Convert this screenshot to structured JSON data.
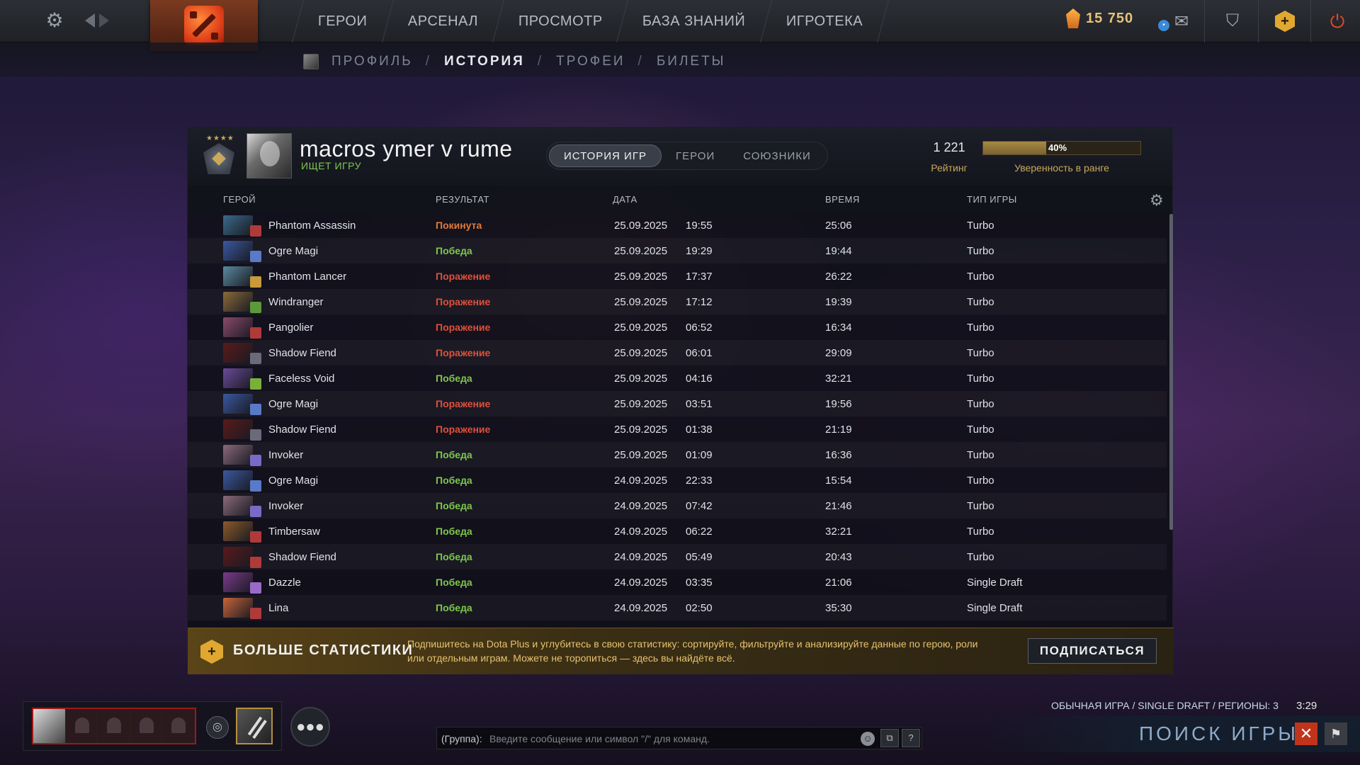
{
  "topbar": {
    "nav": [
      "ГЕРОИ",
      "АРСЕНАЛ",
      "ПРОСМОТР",
      "БАЗА ЗНАНИЙ",
      "ИГРОТЕКА"
    ],
    "currency": "15 750",
    "icons": [
      "settings-icon",
      "back-arrow-icon",
      "forward-arrow-icon",
      "dota-logo",
      "shards-icon",
      "chat-icon",
      "armory-icon",
      "dota-plus-icon",
      "power-icon"
    ]
  },
  "breadcrumb": {
    "items": [
      "ПРОФИЛЬ",
      "ИСТОРИЯ",
      "ТРОФЕИ",
      "БИЛЕТЫ"
    ],
    "active": "ИСТОРИЯ",
    "sep": "/"
  },
  "profile": {
    "name": "macros ymer v rume",
    "status": "ИЩЕТ ИГРУ",
    "tabs": [
      "ИСТОРИЯ ИГР",
      "ГЕРОИ",
      "СОЮЗНИКИ"
    ],
    "active_tab": "ИСТОРИЯ ИГР",
    "rating": "1 221",
    "rating_label": "Рейтинг",
    "confidence": "40%",
    "confidence_fraction": 0.4,
    "confidence_label": "Уверенность в ранге"
  },
  "table": {
    "headers": [
      "ГЕРОЙ",
      "РЕЗУЛЬТАТ",
      "ДАТА",
      "ВРЕМЯ",
      "ТИП ИГРЫ"
    ],
    "rows": [
      {
        "hero": "Phantom Assassin",
        "result": "Покинута",
        "kind": "aband",
        "date": "25.09.2025",
        "time": "19:55",
        "duration": "25:06",
        "type": "Turbo",
        "color": "#3a6a8a",
        "badge": "#b03a3a"
      },
      {
        "hero": "Ogre Magi",
        "result": "Победа",
        "kind": "win",
        "date": "25.09.2025",
        "time": "19:29",
        "duration": "19:44",
        "type": "Turbo",
        "color": "#3a58a0",
        "badge": "#5a7ac8"
      },
      {
        "hero": "Phantom Lancer",
        "result": "Поражение",
        "kind": "loss",
        "date": "25.09.2025",
        "time": "17:37",
        "duration": "26:22",
        "type": "Turbo",
        "color": "#5a8aa0",
        "badge": "#c89a3a"
      },
      {
        "hero": "Windranger",
        "result": "Поражение",
        "kind": "loss",
        "date": "25.09.2025",
        "time": "17:12",
        "duration": "19:39",
        "type": "Turbo",
        "color": "#8a6a3a",
        "badge": "#5a9a3a"
      },
      {
        "hero": "Pangolier",
        "result": "Поражение",
        "kind": "loss",
        "date": "25.09.2025",
        "time": "06:52",
        "duration": "16:34",
        "type": "Turbo",
        "color": "#8a4a6a",
        "badge": "#b03a3a"
      },
      {
        "hero": "Shadow Fiend",
        "result": "Поражение",
        "kind": "loss",
        "date": "25.09.2025",
        "time": "06:01",
        "duration": "29:09",
        "type": "Turbo",
        "color": "#5a1a1a",
        "badge": "#6a6a7a"
      },
      {
        "hero": "Faceless Void",
        "result": "Победа",
        "kind": "win",
        "date": "25.09.2025",
        "time": "04:16",
        "duration": "32:21",
        "type": "Turbo",
        "color": "#6a4a9a",
        "badge": "#7ab03a"
      },
      {
        "hero": "Ogre Magi",
        "result": "Поражение",
        "kind": "loss",
        "date": "25.09.2025",
        "time": "03:51",
        "duration": "19:56",
        "type": "Turbo",
        "color": "#3a58a0",
        "badge": "#5a7ac8"
      },
      {
        "hero": "Shadow Fiend",
        "result": "Поражение",
        "kind": "loss",
        "date": "25.09.2025",
        "time": "01:38",
        "duration": "21:19",
        "type": "Turbo",
        "color": "#5a1a1a",
        "badge": "#6a6a7a"
      },
      {
        "hero": "Invoker",
        "result": "Победа",
        "kind": "win",
        "date": "25.09.2025",
        "time": "01:09",
        "duration": "16:36",
        "type": "Turbo",
        "color": "#8a6a7a",
        "badge": "#7a6ac8"
      },
      {
        "hero": "Ogre Magi",
        "result": "Победа",
        "kind": "win",
        "date": "24.09.2025",
        "time": "22:33",
        "duration": "15:54",
        "type": "Turbo",
        "color": "#3a58a0",
        "badge": "#5a7ac8"
      },
      {
        "hero": "Invoker",
        "result": "Победа",
        "kind": "win",
        "date": "24.09.2025",
        "time": "07:42",
        "duration": "21:46",
        "type": "Turbo",
        "color": "#8a6a7a",
        "badge": "#7a6ac8"
      },
      {
        "hero": "Timbersaw",
        "result": "Победа",
        "kind": "win",
        "date": "24.09.2025",
        "time": "06:22",
        "duration": "32:21",
        "type": "Turbo",
        "color": "#8a5a2a",
        "badge": "#b03a3a"
      },
      {
        "hero": "Shadow Fiend",
        "result": "Победа",
        "kind": "win",
        "date": "24.09.2025",
        "time": "05:49",
        "duration": "20:43",
        "type": "Turbo",
        "color": "#5a1a1a",
        "badge": "#b03a3a"
      },
      {
        "hero": "Dazzle",
        "result": "Победа",
        "kind": "win",
        "date": "24.09.2025",
        "time": "03:35",
        "duration": "21:06",
        "type": "Single Draft",
        "color": "#7a3a8a",
        "badge": "#9a6ac8"
      },
      {
        "hero": "Lina",
        "result": "Победа",
        "kind": "win",
        "date": "24.09.2025",
        "time": "02:50",
        "duration": "35:30",
        "type": "Single Draft",
        "color": "#c8643a",
        "badge": "#b03a3a"
      }
    ]
  },
  "promo": {
    "title": "БОЛЬШЕ СТАТИСТИКИ",
    "text": "Подпишитесь на Dota Plus и углубитесь в свою статистику: сортируйте, фильтруйте и анализируйте данные по герою, роли или отдельным играм. Можете не торопиться — здесь вы найдёте всё.",
    "button": "ПОДПИСАТЬСЯ"
  },
  "chat": {
    "prefix": "(Группа):",
    "placeholder": "Введите сообщение или символ \"/\" для команд.",
    "help": "?"
  },
  "queue": {
    "info": "ОБЫЧНАЯ ИГРА / SINGLE DRAFT / РЕГИОНЫ: 3",
    "timer": "3:29",
    "title": "ПОИСК ИГРЫ",
    "cancel": "✕"
  },
  "colors": {
    "win": "#7ec84a",
    "loss": "#e0503a",
    "abandon": "#e07a3a",
    "accent_gold": "#c9a95a"
  }
}
